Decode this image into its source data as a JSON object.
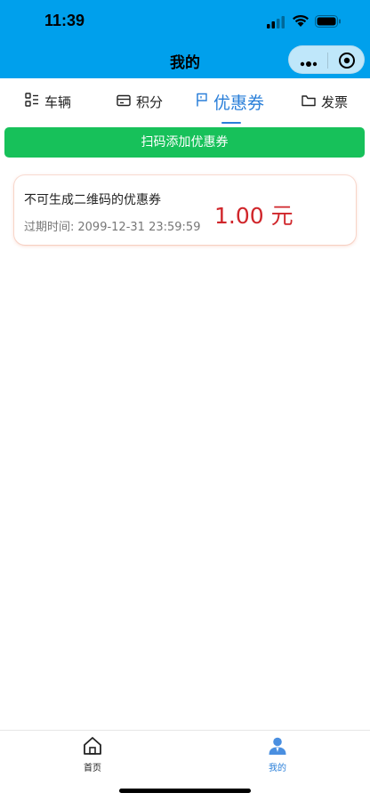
{
  "status_bar": {
    "time": "11:39"
  },
  "nav": {
    "title": "我的"
  },
  "tabs": [
    {
      "label": "车辆",
      "icon": "vehicle-list-icon",
      "active": false
    },
    {
      "label": "积分",
      "icon": "card-icon",
      "active": false
    },
    {
      "label": "优惠券",
      "icon": "flag-icon",
      "active": true
    },
    {
      "label": "发票",
      "icon": "folder-icon",
      "active": false
    }
  ],
  "scan_button": {
    "label": "扫码添加优惠券"
  },
  "coupon": {
    "title": "不可生成二维码的优惠券",
    "expiry_label": "过期时间:",
    "expiry_value": "2099-12-31 23:59:59",
    "amount": "1.00",
    "unit": "元"
  },
  "tabbar": [
    {
      "label": "首页",
      "icon": "home-icon",
      "active": false
    },
    {
      "label": "我的",
      "icon": "person-icon",
      "active": true
    }
  ],
  "colors": {
    "header": "#00a0ec",
    "accent": "#2a7fd9",
    "scan_button": "#17c15a",
    "amount": "#d0262b"
  }
}
